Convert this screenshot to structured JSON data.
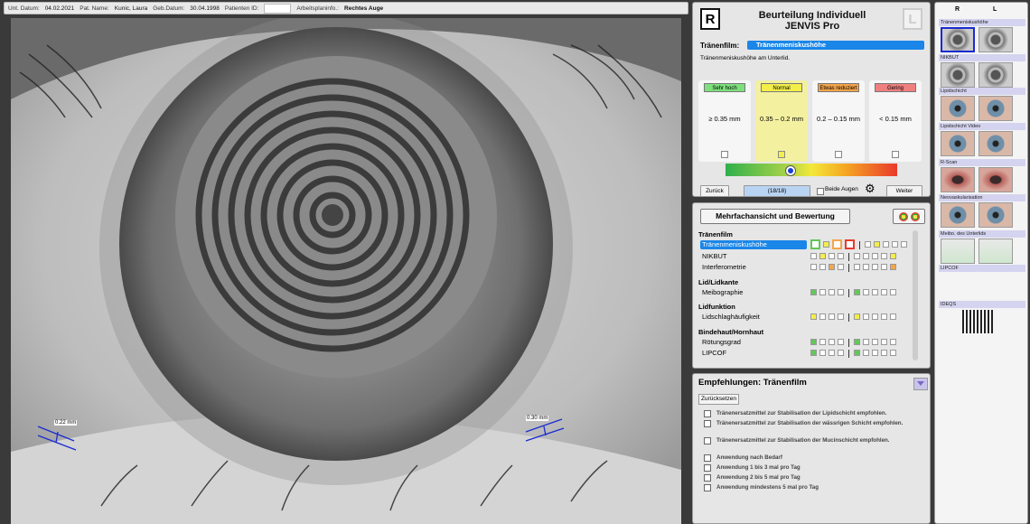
{
  "topbar": {
    "exam_date_label": "Unt. Datum:",
    "exam_date": "04.02.2021",
    "patient_label": "Pat. Name:",
    "patient": "Kunic, Laura",
    "dob_label": "Geb.Datum:",
    "dob": "30.04.1998",
    "patient_id_label": "Patienten ID:",
    "patient_id": "",
    "workplan_label": "Arbeitsplaninfo.:",
    "eye": "Rechtes Auge"
  },
  "measurements": {
    "left": "0.22 mm",
    "right": "0.30 mm"
  },
  "assessment": {
    "r_label": "R",
    "l_label": "L",
    "title_line1": "Beurteilung Individuell",
    "title_line2": "JENVIS Pro",
    "param_label": "Tränenfilm:",
    "param_value": "Tränenmeniskushöhe",
    "description": "Tränenmeniskushöhe am Unterlid.",
    "grades": [
      {
        "label": "Sehr hoch",
        "range": "≥ 0.35 mm",
        "color": "#7de07d",
        "selected": false
      },
      {
        "label": "Normal",
        "range": "0.35 – 0.2 mm",
        "color": "#f3ee4a",
        "selected": true
      },
      {
        "label": "Etwas reduziert",
        "range": "0.2 – 0.15 mm",
        "color": "#f5a54a",
        "selected": false
      },
      {
        "label": "Gering",
        "range": "< 0.15 mm",
        "color": "#f07f7f",
        "selected": false
      }
    ],
    "scale_position": 0.38,
    "back_label": "Zurück",
    "counter": "(18/18)",
    "both_eyes_label": "Beide Augen",
    "next_label": "Weiter",
    "settings_icon": "gear-icon"
  },
  "multiview": {
    "header": "Mehrfachansicht und Bewertung",
    "sections": [
      {
        "title": "Tränenfilm",
        "items": [
          {
            "label": "Tränenmeniskushöhe",
            "selected": true,
            "cells": [
              "green-outline",
              "yellow",
              "orange-outline",
              "red-outline",
              "sep",
              "white",
              "yellow",
              "white",
              "white",
              "white"
            ]
          },
          {
            "label": "NIKBUT",
            "selected": false,
            "cells": [
              "white",
              "yellow",
              "white",
              "white",
              "sep",
              "white",
              "white",
              "white",
              "white",
              "yellow"
            ]
          },
          {
            "label": "Interferometrie",
            "selected": false,
            "cells": [
              "white",
              "white",
              "orange",
              "white",
              "sep",
              "white",
              "white",
              "white",
              "white",
              "orange"
            ]
          }
        ]
      },
      {
        "title": "Lid/Lidkante",
        "items": [
          {
            "label": "Meibographie",
            "selected": false,
            "cells": [
              "green",
              "white",
              "white",
              "white",
              "sep",
              "green",
              "white",
              "white",
              "white",
              "white"
            ]
          }
        ]
      },
      {
        "title": "Lidfunktion",
        "items": [
          {
            "label": "Lidschlaghäufigkeit",
            "selected": false,
            "cells": [
              "yellow",
              "white",
              "white",
              "white",
              "sep",
              "yellow",
              "white",
              "white",
              "white",
              "white"
            ]
          }
        ]
      },
      {
        "title": "Bindehaut/Hornhaut",
        "items": [
          {
            "label": "Rötungsgrad",
            "selected": false,
            "cells": [
              "green",
              "white",
              "white",
              "white",
              "sep",
              "green",
              "white",
              "white",
              "white",
              "white"
            ]
          },
          {
            "label": "LIPCOF",
            "selected": false,
            "cells": [
              "green",
              "white",
              "white",
              "white",
              "sep",
              "green",
              "white",
              "white",
              "white",
              "white"
            ]
          }
        ]
      }
    ]
  },
  "recommendations": {
    "header": "Empfehlungen: Tränenfilm",
    "reset_label": "Zurücksetzen",
    "items": [
      "Tränenersatzmittel zur Stabilisation der Lipidschicht empfohlen.",
      "Tränenersatzmittel zur Stabilisation der wässrigen Schicht empfohlen.",
      "Tränenersatzmittel zur Stabilisation der Mucinschicht empfohlen.",
      "Anwendung nach Bedarf",
      "Anwendung 1 bis 3 mal pro Tag",
      "Anwendung 2 bis 5 mal pro Tag",
      "Anwendung mindestens 5 mal pro Tag"
    ]
  },
  "thumbnails": {
    "r_label": "R",
    "l_label": "L",
    "groups": [
      {
        "label": "Tränenmeniskushöhe",
        "type": "gray"
      },
      {
        "label": "NIKBUT",
        "type": "gray"
      },
      {
        "label": "Lipidschicht",
        "type": "color"
      },
      {
        "label": "Lipidschicht Video",
        "type": "color"
      },
      {
        "label": "R-Scan",
        "type": "red"
      },
      {
        "label": "Neovaskularisation",
        "type": "color"
      },
      {
        "label": "Meibo. des Unterlids",
        "type": "pale"
      },
      {
        "label": "LIPCOF",
        "type": "none"
      },
      {
        "label": "IDEQS",
        "type": "qr"
      }
    ]
  }
}
